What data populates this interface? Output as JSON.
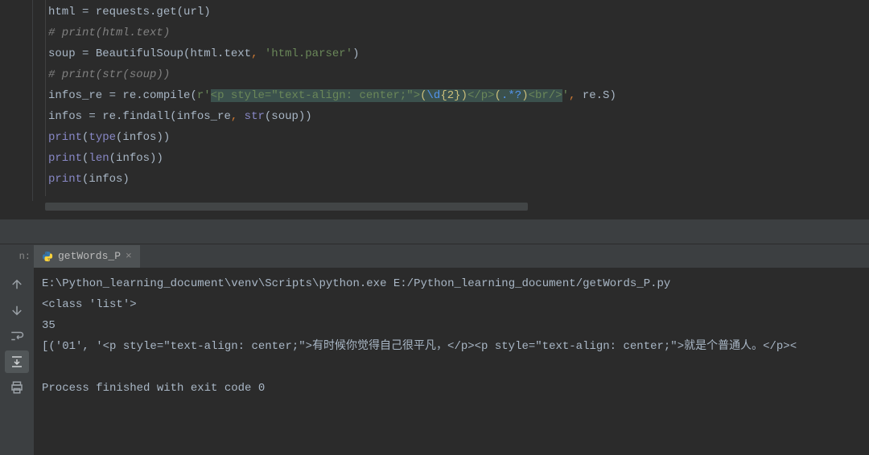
{
  "editor": {
    "lines": [
      {
        "type": "code",
        "frags": [
          {
            "t": "html ",
            "c": "tok-default"
          },
          {
            "t": "=",
            "c": "tok-default"
          },
          {
            "t": " requests.get(url)",
            "c": "tok-default"
          }
        ]
      },
      {
        "type": "comment",
        "text": "# print(html.text)"
      },
      {
        "type": "code",
        "frags": [
          {
            "t": "soup ",
            "c": "tok-default"
          },
          {
            "t": "=",
            "c": "tok-default"
          },
          {
            "t": " BeautifulSoup(html.text",
            "c": "tok-default"
          },
          {
            "t": ", ",
            "c": "tok-keyword"
          },
          {
            "t": "'html.parser'",
            "c": "tok-string"
          },
          {
            "t": ")",
            "c": "tok-default"
          }
        ]
      },
      {
        "type": "comment",
        "text": "# print(str(soup))"
      },
      {
        "type": "code",
        "frags": [
          {
            "t": "infos_re ",
            "c": "tok-default"
          },
          {
            "t": "=",
            "c": "tok-default"
          },
          {
            "t": " re.compile(",
            "c": "tok-default"
          },
          {
            "t": "r'",
            "c": "tok-string"
          },
          {
            "t": "<p style=\"text-align: center;\">",
            "c": "tok-string tok-highlight"
          },
          {
            "t": "(",
            "c": "tok-regex-y tok-highlight"
          },
          {
            "t": "\\d",
            "c": "tok-regex-blue tok-highlight"
          },
          {
            "t": "{2}",
            "c": "tok-regex-y tok-highlight"
          },
          {
            "t": ")",
            "c": "tok-regex-y tok-highlight"
          },
          {
            "t": "</p>",
            "c": "tok-string tok-highlight"
          },
          {
            "t": "(",
            "c": "tok-regex-y tok-highlight"
          },
          {
            "t": ".*?",
            "c": "tok-regex-blue tok-highlight"
          },
          {
            "t": ")",
            "c": "tok-regex-y tok-highlight"
          },
          {
            "t": "<br/>",
            "c": "tok-string tok-highlight"
          },
          {
            "t": "'",
            "c": "tok-string"
          },
          {
            "t": ", ",
            "c": "tok-keyword"
          },
          {
            "t": "re.S)",
            "c": "tok-default"
          }
        ]
      },
      {
        "type": "code",
        "frags": [
          {
            "t": "infos ",
            "c": "tok-default"
          },
          {
            "t": "=",
            "c": "tok-default"
          },
          {
            "t": " re.findall(infos_re",
            "c": "tok-default"
          },
          {
            "t": ", ",
            "c": "tok-keyword"
          },
          {
            "t": "str",
            "c": "tok-builtin"
          },
          {
            "t": "(soup))",
            "c": "tok-default"
          }
        ]
      },
      {
        "type": "code",
        "frags": [
          {
            "t": "print",
            "c": "tok-builtin"
          },
          {
            "t": "(",
            "c": "tok-default"
          },
          {
            "t": "type",
            "c": "tok-builtin"
          },
          {
            "t": "(infos))",
            "c": "tok-default"
          }
        ]
      },
      {
        "type": "code",
        "frags": [
          {
            "t": "print",
            "c": "tok-builtin"
          },
          {
            "t": "(",
            "c": "tok-default"
          },
          {
            "t": "len",
            "c": "tok-builtin"
          },
          {
            "t": "(infos))",
            "c": "tok-default"
          }
        ]
      },
      {
        "type": "code",
        "frags": [
          {
            "t": "print",
            "c": "tok-builtin"
          },
          {
            "t": "(infos)",
            "c": "tok-default"
          }
        ]
      }
    ]
  },
  "run": {
    "label": "n:",
    "tab": {
      "title": "getWords_P",
      "icon": "python"
    },
    "lines": [
      "E:\\Python_learning_document\\venv\\Scripts\\python.exe E:/Python_learning_document/getWords_P.py",
      "<class 'list'>",
      "35",
      "[('01', '<p style=\"text-align: center;\">有时候你觉得自己很平凡，</p><p style=\"text-align: center;\">就是个普通人。</p><",
      "",
      "Process finished with exit code 0"
    ]
  }
}
